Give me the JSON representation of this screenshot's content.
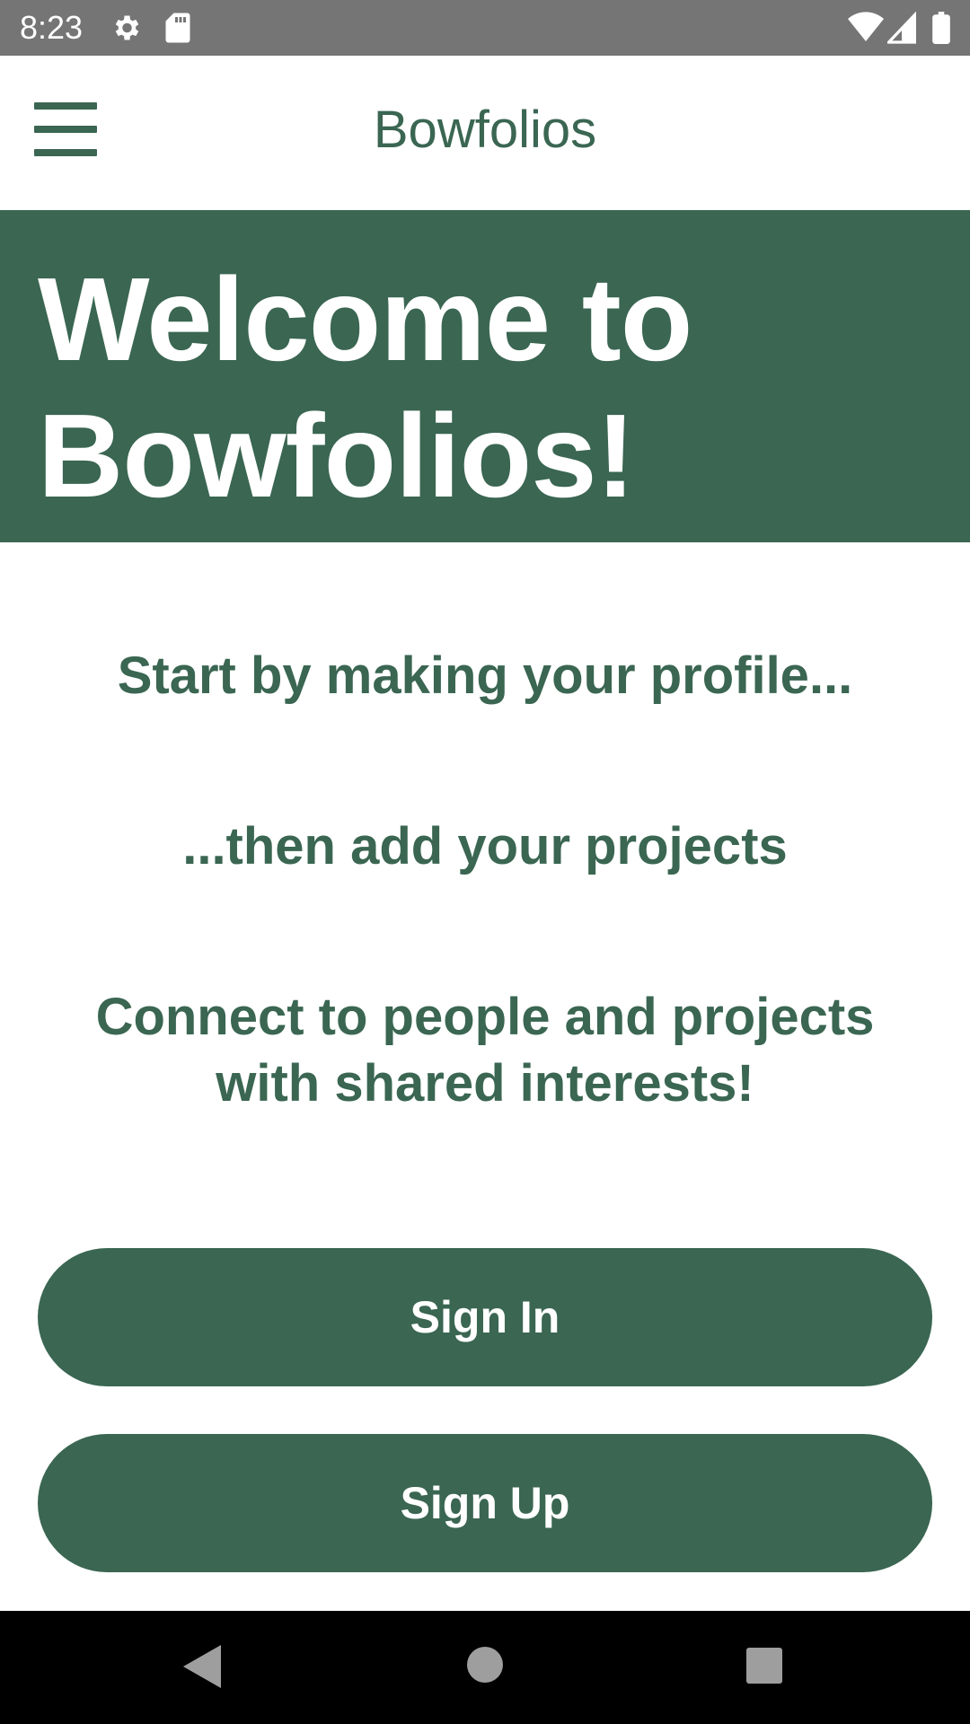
{
  "status_bar": {
    "time": "8:23",
    "icons": [
      "settings-icon",
      "sd-card-icon",
      "wifi-icon",
      "signal-icon",
      "battery-icon"
    ]
  },
  "app_bar": {
    "title": "Bowfolios",
    "menu_icon": "hamburger-menu-icon"
  },
  "hero": {
    "title_line1": "Welcome to",
    "title_line2": "Bowfolios!"
  },
  "taglines": {
    "line1": "Start by making your profile...",
    "line2": "...then add your projects",
    "line3a": "Connect to people and projects",
    "line3b": "with shared interests!"
  },
  "buttons": {
    "sign_in": "Sign In",
    "sign_up": "Sign Up"
  },
  "nav_bar": {
    "icons": [
      "back-icon",
      "home-icon",
      "recents-icon"
    ]
  },
  "colors": {
    "brand_green": "#3a6652",
    "status_bar": "#757575",
    "nav_bar": "#000000"
  }
}
